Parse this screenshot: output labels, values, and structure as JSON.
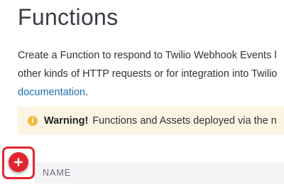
{
  "page": {
    "title": "Functions"
  },
  "description": {
    "line1": "Create a Function to respond to Twilio Webhook Events l",
    "line2": "other kinds of HTTP requests or for integration into Twilio",
    "link_text": "documentation",
    "after_link": "."
  },
  "warning": {
    "icon": "warning-info-icon",
    "icon_glyph": "i",
    "label": "Warning!",
    "text": "Functions and Assets deployed via the n"
  },
  "add_button": {
    "icon": "plus-icon",
    "highlight_color": "#e0262f"
  },
  "table": {
    "columns": [
      "NAME"
    ]
  },
  "colors": {
    "accent_red": "#e4252f",
    "link_blue": "#1f6fb2",
    "warning_bg": "#fdf5e4",
    "warning_icon": "#f0b93a"
  }
}
